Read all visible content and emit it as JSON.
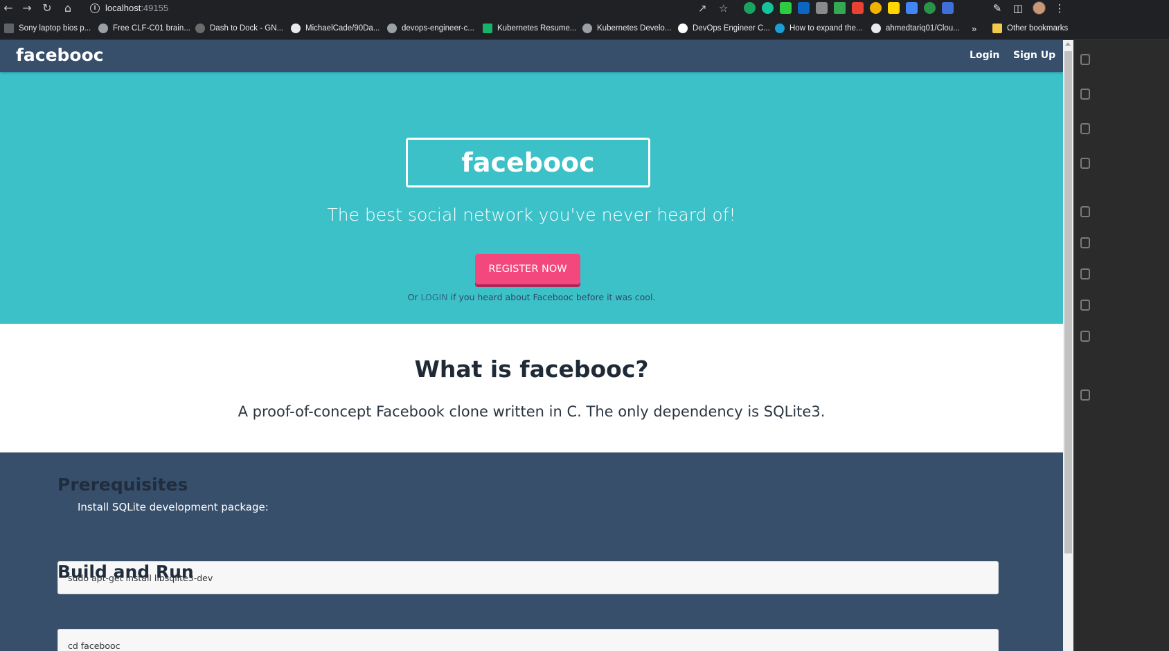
{
  "browser": {
    "url_host": "localhost",
    "url_port": ":49155",
    "bookmarks": [
      "Sony laptop bios p...",
      "Free CLF-C01 brain...",
      "Dash to Dock - GN...",
      "MichaelCade/90Da...",
      "devops-engineer-c...",
      "Kubernetes Resume...",
      "Kubernetes Develo...",
      "DevOps Engineer C...",
      "How to expand the...",
      "ahmedtariq01/Clou..."
    ],
    "more_bookmarks": "»",
    "other_bookmarks": "Other bookmarks"
  },
  "site": {
    "brand": "facebooc",
    "nav": {
      "login": "Login",
      "signup": "Sign Up"
    }
  },
  "hero": {
    "title": "facebooc",
    "tagline": "The best social network you've never heard of!",
    "register_label": "REGISTER NOW",
    "note_prefix": "Or ",
    "note_link": "LOGIN",
    "note_suffix": " if you heard about Facebooc before it was cool."
  },
  "about": {
    "heading": "What is facebooc?",
    "description": "A proof-of-concept Facebook clone written in C. The only dependency is SQLite3."
  },
  "docs": {
    "prereq_heading": "Prerequisites",
    "prereq_instruction": "Install SQLite development package:",
    "prereq_command": "sudo apt-get install libsqlite3-dev",
    "build_heading": "Build and Run",
    "build_command": "cd facebooc"
  },
  "colors": {
    "navbar": "#374f6b",
    "hero": "#3cc1c9",
    "register_button": "#f2487d"
  }
}
